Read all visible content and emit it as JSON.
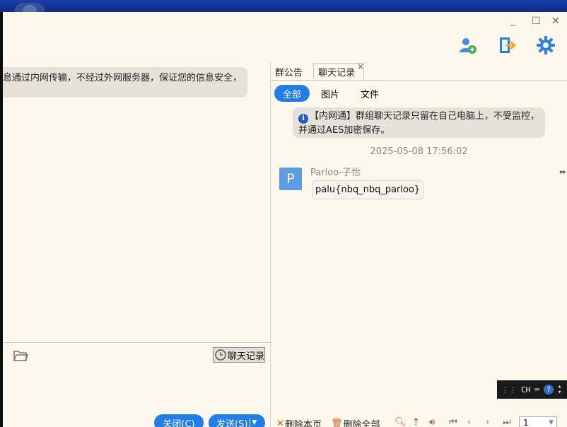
{
  "window_controls": {
    "minimize": "_",
    "maximize": "☐",
    "close": "✕"
  },
  "toolbar": {
    "add_member_icon": "add-user-icon",
    "exit_icon": "exit-icon",
    "settings_icon": "gear-icon"
  },
  "chat": {
    "notice_text": "息通过内网传输，不经过外网服务器，保证您的信息安全，",
    "history_button": "聊天记录",
    "close_button": "关闭(C)",
    "send_button": "发送(S)"
  },
  "side_panel": {
    "tabs": [
      {
        "label": "群公告"
      },
      {
        "label": "聊天记录"
      }
    ],
    "tab_close": "×",
    "filters": [
      "全部",
      "图片",
      "文件"
    ],
    "system_notice_line1": "【内网通】群组聊天记录只留在自己电脑上，不受监控，",
    "system_notice_line2": "并通过AES加密保存。",
    "timestamp": "2025-05-08 17:56:02",
    "message": {
      "avatar_letter": "P",
      "sender": "Parloo-子怡",
      "text": "palu{nbq_nbq_parloo}"
    },
    "delete_page": "删除本页",
    "delete_all": "删除全部",
    "page_value": "1"
  },
  "ime_bar": {
    "lang": "CH"
  },
  "colors": {
    "accent": "#1f7ee8",
    "background": "#fdf8ec"
  }
}
